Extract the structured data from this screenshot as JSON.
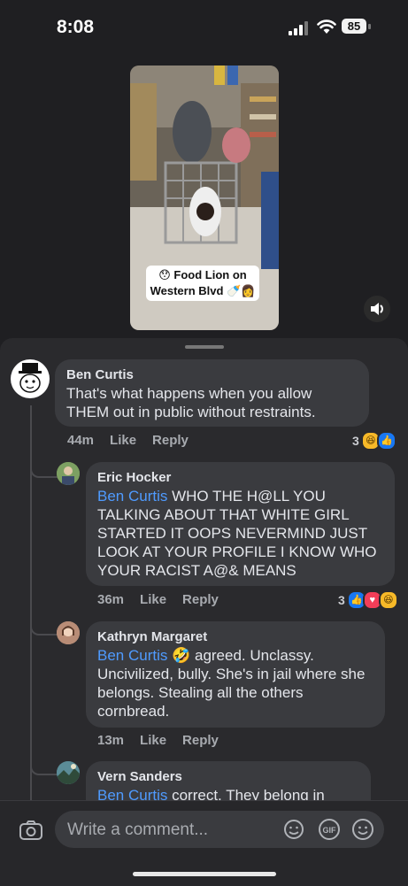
{
  "status_bar": {
    "time": "8:08",
    "battery": "85",
    "icons": [
      "signal-icon",
      "wifi-icon",
      "battery-icon"
    ]
  },
  "video": {
    "caption_line1": "😯 Food Lion on",
    "caption_line2": "Western Blvd 🍼👩",
    "sound_icon": "speaker-icon"
  },
  "comments": [
    {
      "author": "Ben Curtis",
      "text": "That's what happens when you allow THEM out in public without restraints.",
      "time": "44m",
      "like": "Like",
      "reply": "Reply",
      "reaction_count": "3",
      "reactions": [
        "haha",
        "like"
      ]
    },
    {
      "author": "Eric Hocker",
      "mention": "Ben Curtis",
      "text": " WHO THE H@LL YOU TALKING ABOUT THAT WHITE GIRL STARTED IT OOPS NEVERMIND JUST LOOK AT YOUR PROFILE I KNOW WHO YOUR RACIST A@& MEANS",
      "time": "36m",
      "like": "Like",
      "reply": "Reply",
      "reaction_count": "3",
      "reactions": [
        "like",
        "love",
        "haha"
      ]
    },
    {
      "author": "Kathryn Margaret",
      "mention": "Ben Curtis",
      "text": " 🤣 agreed. Unclassy. Uncivilized, bully. She's in jail where she belongs. Stealing all the others cornbread.",
      "time": "13m",
      "like": "Like",
      "reply": "Reply"
    },
    {
      "author": "Vern Sanders",
      "mention": "Ben Curtis",
      "text": " correct. They belong in"
    }
  ],
  "composer": {
    "placeholder": "Write a comment...",
    "icons": [
      "camera-icon",
      "sticker-icon",
      "gif-icon",
      "emoji-icon"
    ]
  },
  "colors": {
    "background": "#1f1f22",
    "panel": "#2a2a2d",
    "bubble": "#3a3b3f",
    "mention": "#4f9bff"
  }
}
